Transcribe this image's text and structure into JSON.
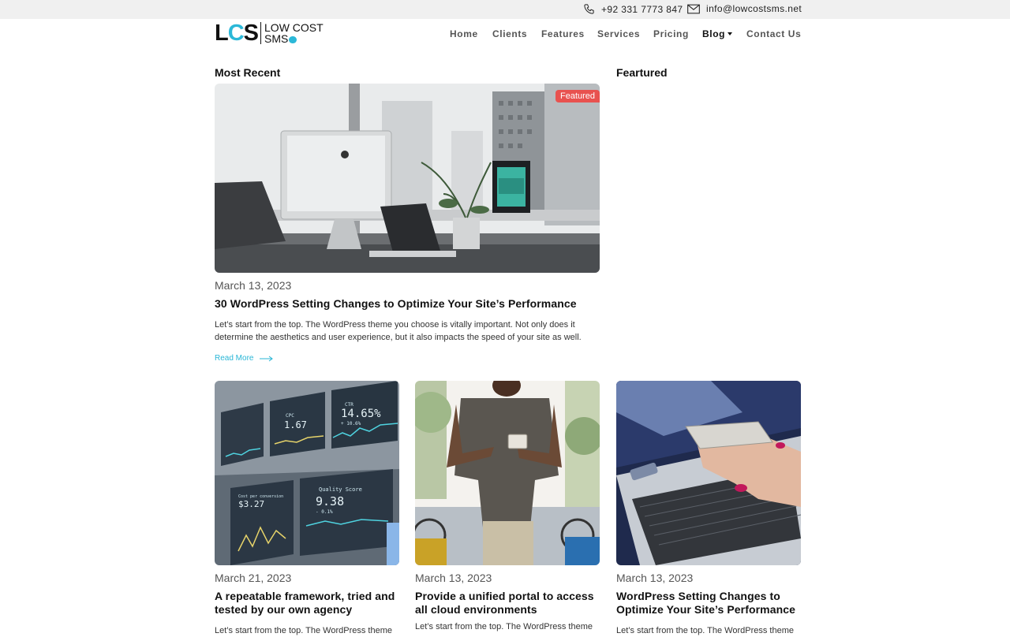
{
  "topbar": {
    "phone": "+92 331 7773 847",
    "email": "info@lowcostsms.net"
  },
  "logo": {
    "mark_l": "L",
    "mark_c": "C",
    "mark_s": "S",
    "line1": "LOW COST",
    "line2": "SMS"
  },
  "nav": {
    "items": [
      {
        "label": "Home"
      },
      {
        "label": "Clients"
      },
      {
        "label": "Features"
      },
      {
        "label": "Services"
      },
      {
        "label": "Pricing"
      },
      {
        "label": "Blog"
      },
      {
        "label": "Contact Us"
      }
    ],
    "active": "Blog"
  },
  "sections": {
    "most_recent": "Most Recent",
    "featured": "Feartured"
  },
  "featured_post": {
    "badge": "Featured",
    "date": "March 13, 2023",
    "title": "30 WordPress Setting Changes to Optimize Your Site’s Performance",
    "excerpt": "Let’s start from the top. The WordPress theme you choose is vitally important. Not only does it determine the aesthetics and user experience, but it also impacts the speed of your site as well.",
    "read_more": "Read More"
  },
  "posts": [
    {
      "date": "March 21, 2023",
      "title": "A repeatable framework, tried and tested by our own agency",
      "excerpt": "Let’s start from the top. The WordPress theme"
    },
    {
      "date": "March 13, 2023",
      "title": "Provide a unified portal to access all cloud environments",
      "excerpt": "Let’s start from the top. The WordPress theme"
    },
    {
      "date": "March 13, 2023",
      "title": "WordPress Setting Changes to Optimize Your Site’s Performance",
      "excerpt": "Let’s start from the top. The WordPress theme"
    }
  ],
  "dashboard_image": {
    "cards": [
      {
        "label": "CTR",
        "value": "14.65%",
        "delta": "+ 10.6%"
      },
      {
        "label": "CPC",
        "value": "1.67"
      },
      {
        "label": "Cost per conversion",
        "value": "$3.27"
      },
      {
        "label": "Quality Score",
        "value": "9.38",
        "delta": "- 0.1%"
      }
    ]
  },
  "colors": {
    "accent": "#2bb8d8",
    "badge": "#e8524f",
    "topbar_bg": "#f0f0f0"
  },
  "icons": [
    "phone-icon",
    "mail-icon",
    "arrow-right-icon",
    "caret-down-icon"
  ]
}
